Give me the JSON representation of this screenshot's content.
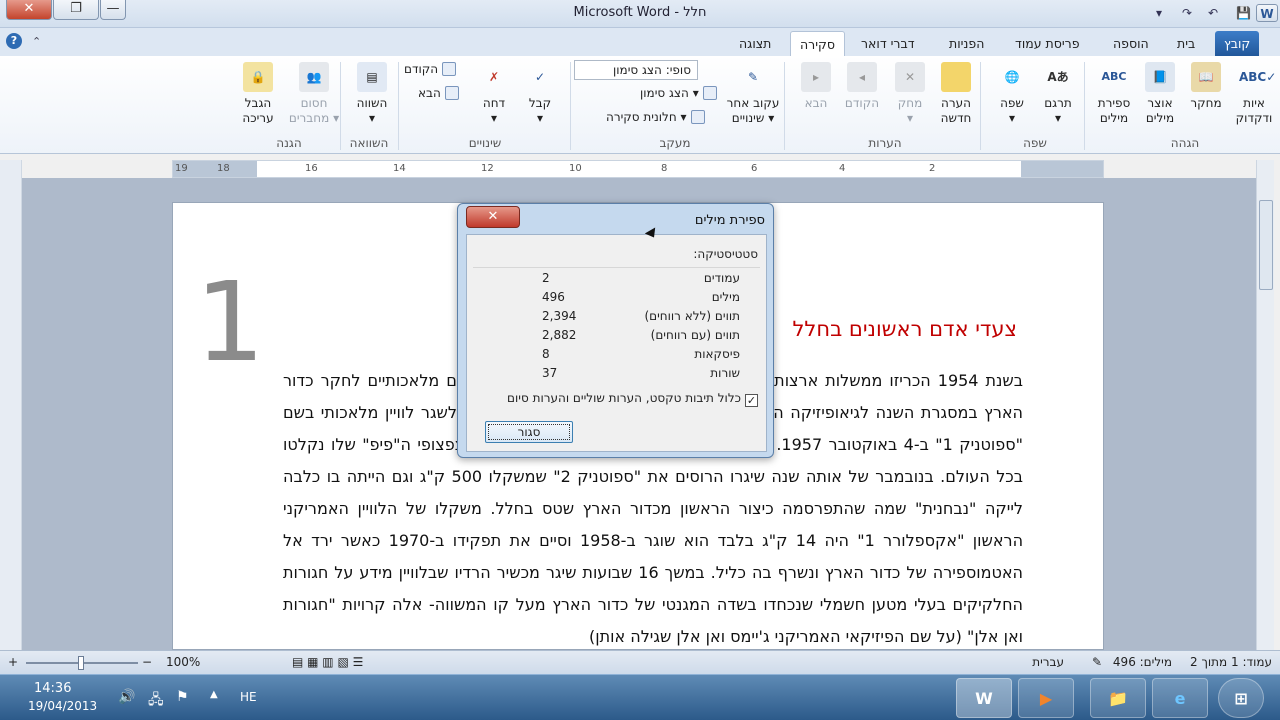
{
  "window": {
    "title": "Microsoft Word - חלל",
    "min": "–",
    "max": "□",
    "close": "✕"
  },
  "qat": {
    "save": "💾",
    "undo": "↶",
    "redo": "↷",
    "more": "▾"
  },
  "winctl": {
    "close": "✕",
    "restore": "❐",
    "min": "—"
  },
  "tabs": [
    "קובץ",
    "בית",
    "הוספה",
    "פריסת עמוד",
    "הפניות",
    "דברי דואר",
    "סקירה",
    "תצוגה"
  ],
  "ribbon": {
    "spelling": "איות\nודקדוק",
    "research": "מחקר",
    "thesaurus": "אוצר\nמילים",
    "wordcount": "ספירת\nמילים",
    "translate": "תרגם",
    "language": "שפה",
    "newcomment": "הערה\nחדשה",
    "delete": "מחק",
    "previous": "הקודם",
    "next": "הבא",
    "trackchanges": "עקוב אחר\nשינויים",
    "markup_dropdown": "סופי: הצג סימון",
    "showmarkup": "הצג סימון",
    "reviewpane": "חלונית סקירה",
    "accept": "קבל",
    "reject": "דחה",
    "prev_change": "הקודם",
    "next_change": "הבא",
    "compare": "השווה",
    "block_authors": "חסום\nמחברים",
    "restrict": "הגבל\nעריכה",
    "groups": {
      "proofing": "הגהה",
      "language": "שפה",
      "comments": "הערות",
      "tracking": "מעקב",
      "changes": "שינויים",
      "compare": "השוואה",
      "protect": "הגנה"
    }
  },
  "ruler": {
    "ticks": [
      "2",
      "4",
      "6",
      "8",
      "10",
      "12",
      "14",
      "16",
      "18",
      "19"
    ]
  },
  "document": {
    "number": "1",
    "heading": "צעדי אדם ראשונים בחלל",
    "paragraph": "בשנת 1954 הכריזו ממשלות ארצות הברית וברית המועצות על כוונתן לשגר לוויינים מלאכותיים לחקר כדור הארץ במסגרת השנה לגיאופיזיקה הבינלאומית. הסובייטים היו הראשונים שהצליחו לשגר לוויין מלאכותי בשם \"ספוטניק 1\" ב-4 באוקטובר 1957. הלוויין ששקל 83 ק\"ג נשא רק משדר רדיו שצפצופי ה\"פיפ\" שלו נקלטו בכל העולם. בנובמבר של אותה שנה שיגרו הרוסים את \"ספוטניק 2\" שמשקלו 500 ק\"ג וגם הייתה בו כלבה לייקה \"נבחנית\" שמה שהתפרסמה כיצור הראשון מכדור הארץ שטס בחלל. משקלו של הלוויין האמריקני הראשון \"אקספלורר 1\" היה 14 ק\"ג בלבד הוא שוגר ב-1958 וסיים את תפקידו ב-1970 כאשר ירד אל האטמוספירה של כדור הארץ ונשרף בה כליל. במשך 16 שבועות שיגר מכשיר הרדיו שבלוויין מידע על חגורות החלקיקים בעלי מטען חשמלי שנכחדו בשדה המגנטי של כדור הארץ מעל קו המשווה- אלה קרויות \"חגורות ואן אלן\" (על שם הפיזיקאי האמריקני ג'יימס ואן אלן שגילה אותן)"
  },
  "dialog": {
    "title": "ספירת מילים",
    "close": "✕",
    "section": "סטטיסטיקה:",
    "rows": [
      {
        "label": "עמודים",
        "value": "2"
      },
      {
        "label": "מילים",
        "value": "496"
      },
      {
        "label": "תווים (ללא רווחים)",
        "value": "2,394"
      },
      {
        "label": "תווים (עם רווחים)",
        "value": "2,882"
      },
      {
        "label": "פיסקאות",
        "value": "8"
      },
      {
        "label": "שורות",
        "value": "37"
      }
    ],
    "checkbox": "כלול תיבות טקסט, הערות שוליים והערות סיום",
    "checkbox_checked": true,
    "button": "סגור"
  },
  "status": {
    "page": "עמוד: 1 מתוך 2",
    "words": "מילים: 496",
    "language": "עברית",
    "zoom": "100%",
    "zoom_minus": "−",
    "zoom_plus": "+",
    "zoom_level_percent": 100
  },
  "taskbar": {
    "time": "14:36",
    "date": "19/04/2013",
    "lang": "HE",
    "apps": [
      "W",
      "▶",
      "📁",
      "e",
      "⊞"
    ]
  }
}
